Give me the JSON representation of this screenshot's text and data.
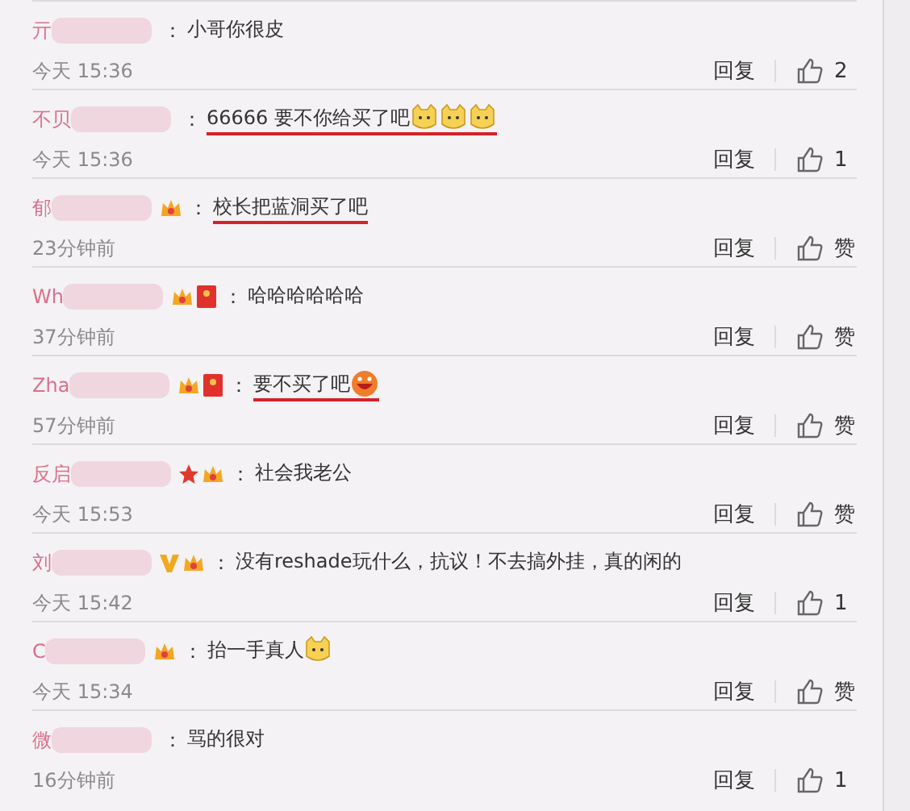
{
  "comments": [
    {
      "name": "亓",
      "separator": "：",
      "text": "小哥你很皮",
      "underlined": false,
      "time": "今天 15:36",
      "reply": "回复",
      "likes": "2"
    },
    {
      "name": "不贝",
      "separator": "：",
      "text": "66666 要不你给买了吧",
      "emojis": [
        {
          "kind": "cat"
        },
        {
          "kind": "cat"
        },
        {
          "kind": "cat"
        }
      ],
      "underlined": true,
      "time": "今天 15:36",
      "reply": "回复",
      "likes": "1"
    },
    {
      "name": "郁",
      "badges": [
        {
          "kind": "fan"
        }
      ],
      "separator": "：",
      "text": "校长把蓝洞买了吧",
      "underlined": true,
      "time": "23分钟前",
      "reply": "回复",
      "likes": "赞"
    },
    {
      "name": "Wh",
      "badges": [
        {
          "kind": "fan"
        },
        {
          "kind": "hongbao"
        }
      ],
      "separator": "：",
      "text": "哈哈哈哈哈哈",
      "underlined": false,
      "time": "37分钟前",
      "reply": "回复",
      "likes": "赞"
    },
    {
      "name": "Zha",
      "badges": [
        {
          "kind": "fan"
        },
        {
          "kind": "hongbao"
        }
      ],
      "separator": "：",
      "text": "要不买了吧",
      "emojis": [
        {
          "kind": "grin"
        }
      ],
      "underlined": true,
      "time": "57分钟前",
      "reply": "回复",
      "likes": "赞"
    },
    {
      "name": "反启",
      "badges": [
        {
          "kind": "star"
        },
        {
          "kind": "fan"
        }
      ],
      "separator": "：",
      "text": "社会我老公",
      "underlined": false,
      "time": "今天 15:53",
      "reply": "回复",
      "likes": "赞"
    },
    {
      "name": "刘",
      "badges": [
        {
          "kind": "vip"
        },
        {
          "kind": "fan"
        }
      ],
      "separator": "：",
      "text": "没有reshade玩什么，抗议！不去搞外挂，真的闲的",
      "underlined": false,
      "time": "今天 15:42",
      "reply": "回复",
      "likes": "1"
    },
    {
      "name": "C",
      "badges": [
        {
          "kind": "fan"
        }
      ],
      "separator": "：",
      "text": "抬一手真人",
      "emojis": [
        {
          "kind": "cat"
        }
      ],
      "underlined": false,
      "time": "今天 15:34",
      "reply": "回复",
      "likes": "赞"
    },
    {
      "name": "微",
      "separator": "：",
      "text": "骂的很对",
      "underlined": false,
      "time": "16分钟前",
      "reply": "回复",
      "likes": "1"
    }
  ]
}
